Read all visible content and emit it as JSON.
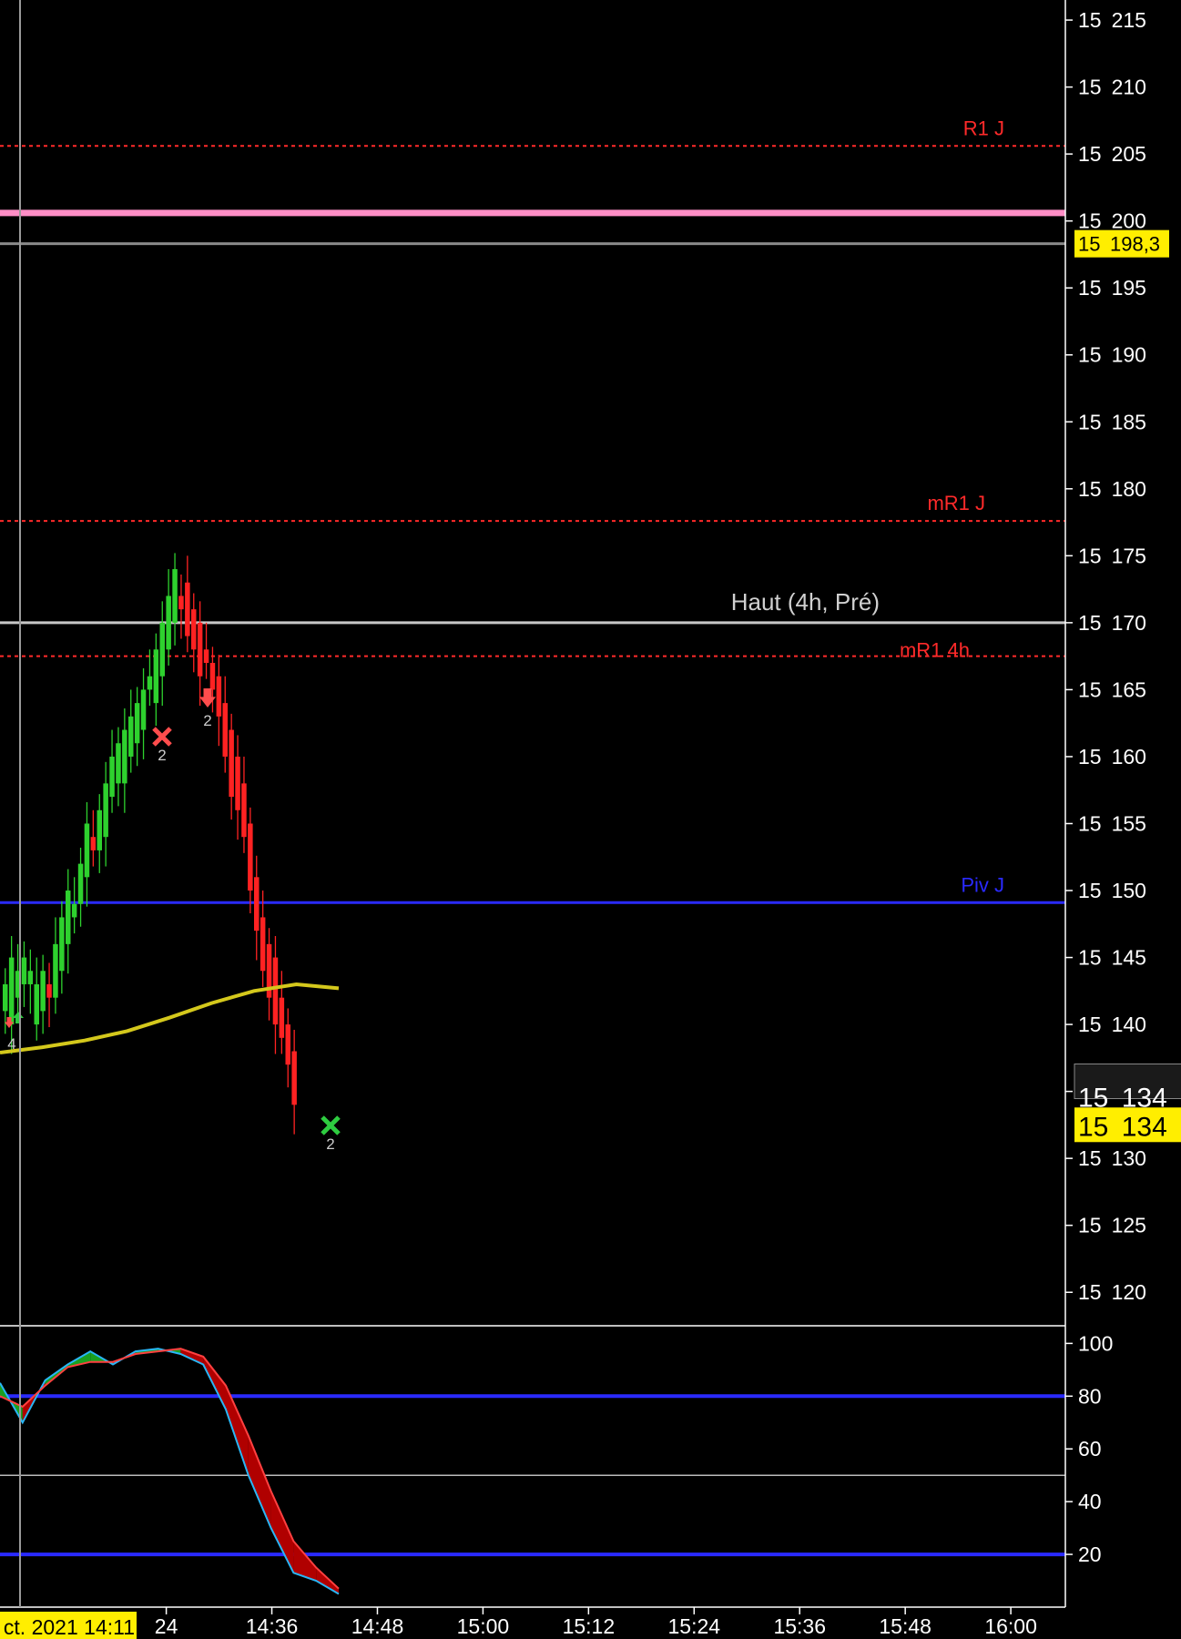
{
  "chart_data": [
    {
      "type": "candlestick",
      "panel": "price",
      "y_ticks": [
        "15 215",
        "15 210",
        "15 205",
        "15 200",
        "15 195",
        "15 190",
        "15 185",
        "15 180",
        "15 175",
        "15 170",
        "15 165",
        "15 160",
        "15 155",
        "15 150",
        "15 145",
        "15 140",
        "15 135",
        "15 130",
        "15 125",
        "15 120"
      ],
      "y_tick_values": [
        15215,
        15210,
        15205,
        15200,
        15195,
        15190,
        15185,
        15180,
        15175,
        15170,
        15165,
        15160,
        15155,
        15150,
        15145,
        15140,
        15135,
        15130,
        15125,
        15120
      ],
      "ylim": [
        15117.5,
        15216.5
      ],
      "x_ticks": [
        "24",
        "14:36",
        "14:48",
        "15:00",
        "15:12",
        "15:24",
        "15:36",
        "15:48",
        "16:00"
      ],
      "x_tick_minutes": [
        864,
        876,
        888,
        900,
        912,
        924,
        936,
        948,
        960
      ],
      "xlim_minutes": [
        845.1,
        966.2
      ],
      "date_flag": "ct. 2021 14:11",
      "date_flag_minute": 847.3,
      "price_flags": [
        "15 198,3",
        "15 134",
        "15 134"
      ],
      "levels": [
        {
          "label": "R1 J",
          "value": 15205.6,
          "color": "#ff2a2a",
          "style": "dotted"
        },
        {
          "label": "",
          "value": 15200.6,
          "color": "#ff8ec6",
          "style": "solid"
        },
        {
          "label": "",
          "value": 15198.3,
          "color": "#8a8a8a",
          "style": "solid"
        },
        {
          "label": "mR1 J",
          "value": 15177.6,
          "color": "#ff2a2a",
          "style": "dotted"
        },
        {
          "label": "Haut (4h, Pré)",
          "value": 15170.0,
          "color": "#c8c8c8",
          "style": "solid"
        },
        {
          "label": "mR1 4h",
          "value": 15167.5,
          "color": "#ff2a2a",
          "style": "dotted"
        },
        {
          "label": "Piv J",
          "value": 15149.1,
          "color": "#2a2aff",
          "style": "solid"
        }
      ],
      "candles_oc": [
        [
          15141,
          15143
        ],
        [
          15140,
          15145
        ],
        [
          15142,
          15144
        ],
        [
          15143,
          15145
        ],
        [
          15143,
          15144
        ],
        [
          15140,
          15143
        ],
        [
          15141,
          15144
        ],
        [
          15143,
          15142
        ],
        [
          15142,
          15146
        ],
        [
          15144,
          15148
        ],
        [
          15146,
          15150
        ],
        [
          15148,
          15149
        ],
        [
          15149,
          15152
        ],
        [
          15151,
          15155
        ],
        [
          15154,
          15153
        ],
        [
          15153,
          15156
        ],
        [
          15154,
          15158
        ],
        [
          15157,
          15160
        ],
        [
          15158,
          15161
        ],
        [
          15158,
          15162
        ],
        [
          15160,
          15163
        ],
        [
          15161,
          15164
        ],
        [
          15162,
          15165
        ],
        [
          15165,
          15166
        ],
        [
          15164,
          15168
        ],
        [
          15166,
          15170
        ],
        [
          15168,
          15172
        ],
        [
          15170,
          15174
        ],
        [
          15172,
          15171
        ],
        [
          15173,
          15169
        ],
        [
          15171,
          15168
        ],
        [
          15170,
          15166
        ],
        [
          15168,
          15167
        ],
        [
          15167,
          15165
        ],
        [
          15166,
          15163
        ],
        [
          15164,
          15160
        ],
        [
          15162,
          15157
        ],
        [
          15160,
          15156
        ],
        [
          15158,
          15154
        ],
        [
          15155,
          15150
        ],
        [
          15151,
          15147
        ],
        [
          15148,
          15144
        ],
        [
          15146,
          15142
        ],
        [
          15145,
          15140
        ],
        [
          15142,
          15139
        ],
        [
          15140,
          15137
        ],
        [
          15138,
          15134
        ]
      ],
      "signals": [
        {
          "kind": "up-arrow",
          "label": "",
          "color": "#2ecc40"
        },
        {
          "kind": "down-arrow",
          "label": "4",
          "color": "#ff4d4d"
        },
        {
          "kind": "cross",
          "label": "2",
          "color": "#ff4d4d"
        },
        {
          "kind": "down-arrow",
          "label": "2",
          "color": "#ff4d4d"
        },
        {
          "kind": "cross",
          "label": "2",
          "color": "#2ecc40"
        }
      ],
      "moving_average": {
        "color": "#d4c81c",
        "values": [
          15137.9,
          15138.3,
          15138.8,
          15139.5,
          15140.5,
          15141.6,
          15142.5,
          15143.0,
          15142.7
        ]
      }
    },
    {
      "type": "line",
      "panel": "oscillator",
      "y_ticks": [
        "100",
        "80",
        "60",
        "40",
        "20"
      ],
      "y_tick_values": [
        100,
        80,
        60,
        40,
        20
      ],
      "ylim": [
        0,
        106
      ],
      "bands": [
        {
          "value": 80,
          "color": "#2a2aff"
        },
        {
          "value": 50,
          "color": "#bbbbbb"
        },
        {
          "value": 20,
          "color": "#2a2aff"
        }
      ],
      "series": [
        {
          "role": "fast",
          "color": "#29b6f6",
          "values": [
            85,
            70,
            86,
            92,
            97,
            92,
            97,
            98,
            96,
            92,
            75,
            50,
            30,
            13,
            10,
            5
          ]
        },
        {
          "role": "slow",
          "color": "#ff4040",
          "values": [
            80,
            76,
            84,
            91,
            93,
            93,
            96,
            97,
            98,
            95,
            84,
            65,
            44,
            25,
            15,
            7
          ]
        }
      ]
    }
  ],
  "colors": {
    "bull": "#2ed12e",
    "bear": "#ff2222",
    "fill_bull": "#1aa020",
    "fill_bear": "#b00000",
    "flag_yellow": "#ffee00"
  }
}
